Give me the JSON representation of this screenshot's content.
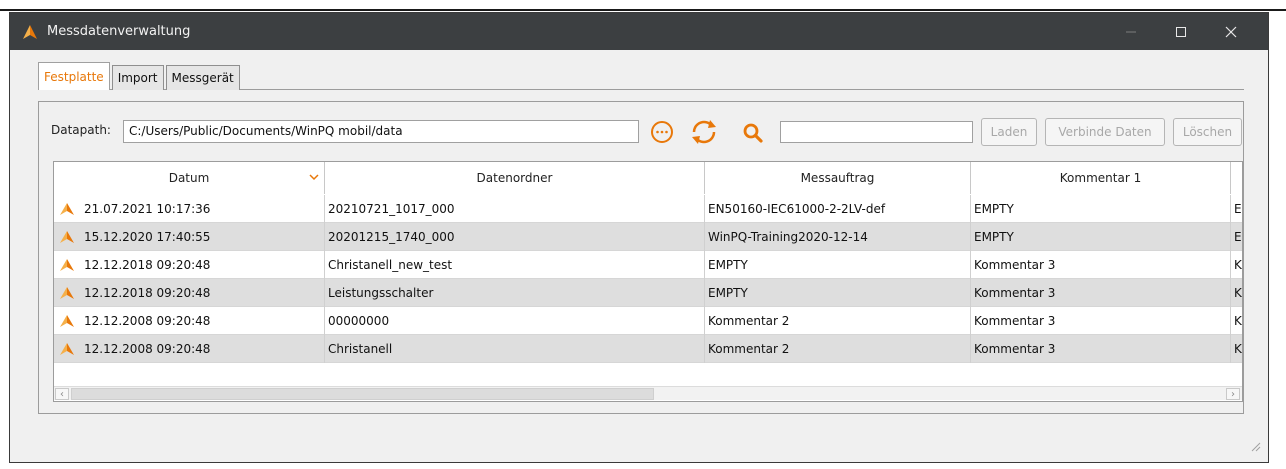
{
  "window": {
    "title": "Messdatenverwaltung",
    "minimize_icon": "minimize-icon",
    "maximize_icon": "maximize-icon",
    "close_icon": "close-icon"
  },
  "tabs": [
    {
      "label": "Festplatte",
      "active": true
    },
    {
      "label": "Import",
      "active": false
    },
    {
      "label": "Messgerät",
      "active": false
    }
  ],
  "datapath": {
    "label": "Datapath:",
    "value": "C:/Users/Public/Documents/WinPQ mobil/data"
  },
  "toolbar": {
    "browse_icon": "more-icon",
    "refresh_icon": "refresh-icon",
    "search_icon": "search-icon",
    "search_value": "",
    "load_label": "Laden",
    "connect_label": "Verbinde Daten",
    "delete_label": "Löschen",
    "accent_color": "#e8780a"
  },
  "table": {
    "columns": [
      "Datum",
      "Datenordner",
      "Messauftrag",
      "Kommentar 1"
    ],
    "sort_icon": "chevron-down-icon",
    "rows": [
      {
        "datum": "21.07.2021 10:17:36",
        "datenordner": "20210721_1017_000",
        "messauftrag": "EN50160-IEC61000-2-2LV-def",
        "kommentar1": "EMPTY",
        "next": "E"
      },
      {
        "datum": "15.12.2020 17:40:55",
        "datenordner": "20201215_1740_000",
        "messauftrag": "WinPQ-Training2020-12-14",
        "kommentar1": "EMPTY",
        "next": "E"
      },
      {
        "datum": "12.12.2018 09:20:48",
        "datenordner": "Christanell_new_test",
        "messauftrag": "EMPTY",
        "kommentar1": "Kommentar 3",
        "next": "K"
      },
      {
        "datum": "12.12.2018 09:20:48",
        "datenordner": "Leistungsschalter",
        "messauftrag": "EMPTY",
        "kommentar1": "Kommentar 3",
        "next": "K"
      },
      {
        "datum": "12.12.2008 09:20:48",
        "datenordner": "00000000",
        "messauftrag": "Kommentar 2",
        "kommentar1": "Kommentar 3",
        "next": "K"
      },
      {
        "datum": "12.12.2008 09:20:48",
        "datenordner": "Christanell",
        "messauftrag": "Kommentar 2",
        "kommentar1": "Kommentar 3",
        "next": "K"
      }
    ]
  }
}
